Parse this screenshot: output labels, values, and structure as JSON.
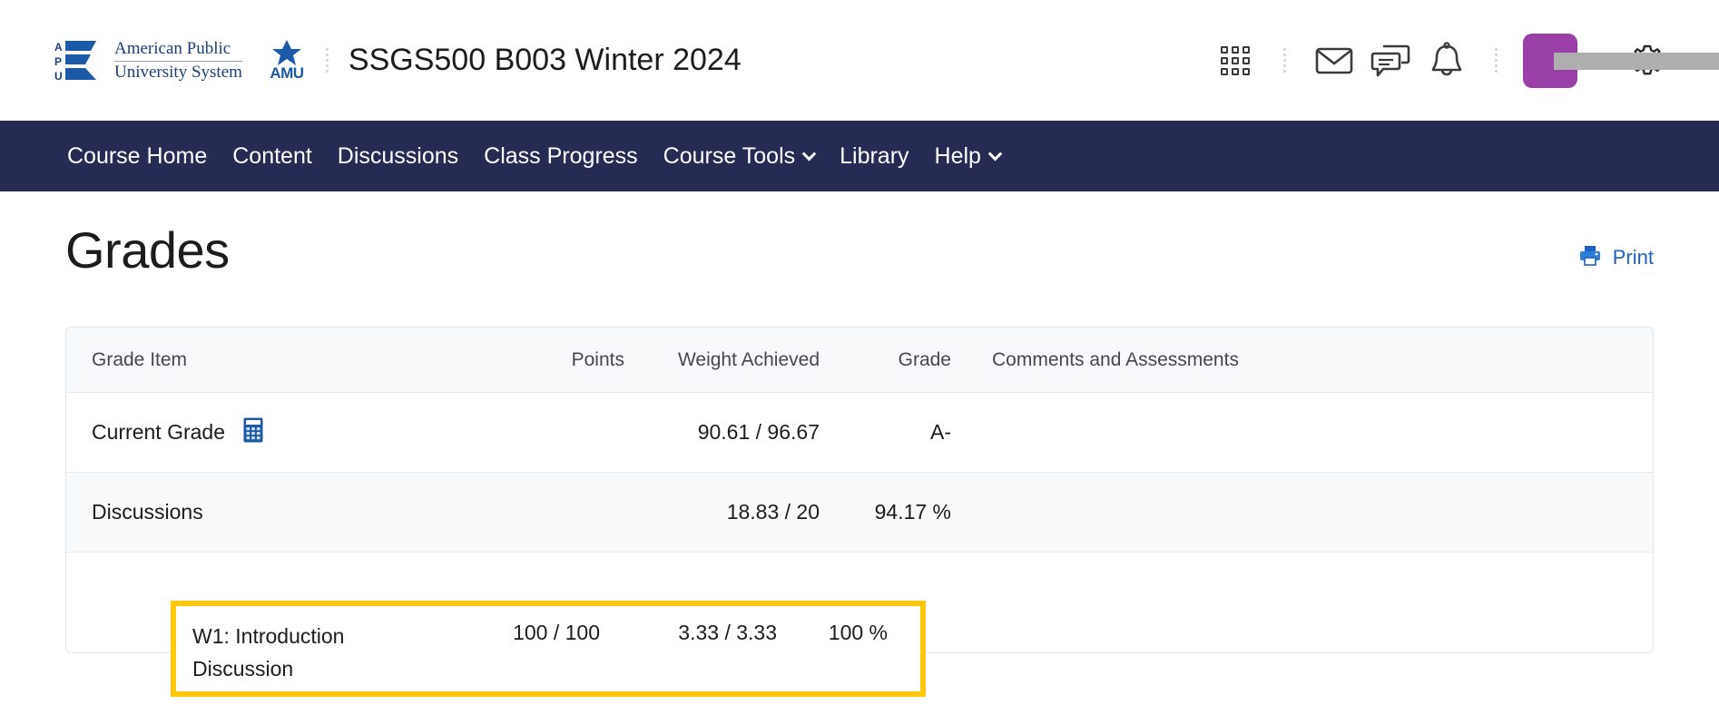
{
  "brand": {
    "logo_icon": "apus-logo-icon",
    "name_line1": "American Public",
    "name_line2": "University System",
    "amu_label": "AMU",
    "star_icon": "star-icon"
  },
  "header": {
    "course_title": "SSGS500 B003 Winter 2024",
    "icons": [
      {
        "name": "waffle-grid-icon",
        "label": "Course Selector"
      },
      {
        "name": "envelope-icon",
        "label": "Email"
      },
      {
        "name": "chat-bubbles-icon",
        "label": "Messages"
      },
      {
        "name": "bell-icon",
        "label": "Notifications"
      },
      {
        "name": "gear-icon",
        "label": "Settings"
      }
    ],
    "avatar_color": "#9b3fa8",
    "username_redacted": ""
  },
  "nav": {
    "items": [
      {
        "label": "Course Home",
        "has_chevron": false
      },
      {
        "label": "Content",
        "has_chevron": false
      },
      {
        "label": "Discussions",
        "has_chevron": false
      },
      {
        "label": "Class Progress",
        "has_chevron": false
      },
      {
        "label": "Course Tools",
        "has_chevron": true
      },
      {
        "label": "Library",
        "has_chevron": false
      },
      {
        "label": "Help",
        "has_chevron": true
      }
    ],
    "background": "#262b54"
  },
  "page": {
    "title": "Grades",
    "print_label": "Print",
    "print_icon": "printer-icon",
    "accent_link_color": "#1b62c4"
  },
  "grades_table": {
    "columns": [
      "Grade Item",
      "Points",
      "Weight Achieved",
      "Grade",
      "Comments and Assessments"
    ],
    "rows": [
      {
        "item": "Current Grade",
        "icon": "calculator-icon",
        "points": "",
        "weight": "90.61 / 96.67",
        "grade": "A-",
        "comments": ""
      },
      {
        "item": "Discussions",
        "icon": "",
        "points": "",
        "weight": "18.83 / 20",
        "grade": "94.17 %",
        "comments": ""
      },
      {
        "item": "W1: Introduction Discussion",
        "item_line1": "W1: Introduction",
        "item_line2": "Discussion",
        "icon": "",
        "points": "100 / 100",
        "weight": "3.33 / 3.33",
        "grade": "100 %",
        "comments": "",
        "highlighted": true,
        "highlight_color": "#ffc709"
      }
    ]
  }
}
